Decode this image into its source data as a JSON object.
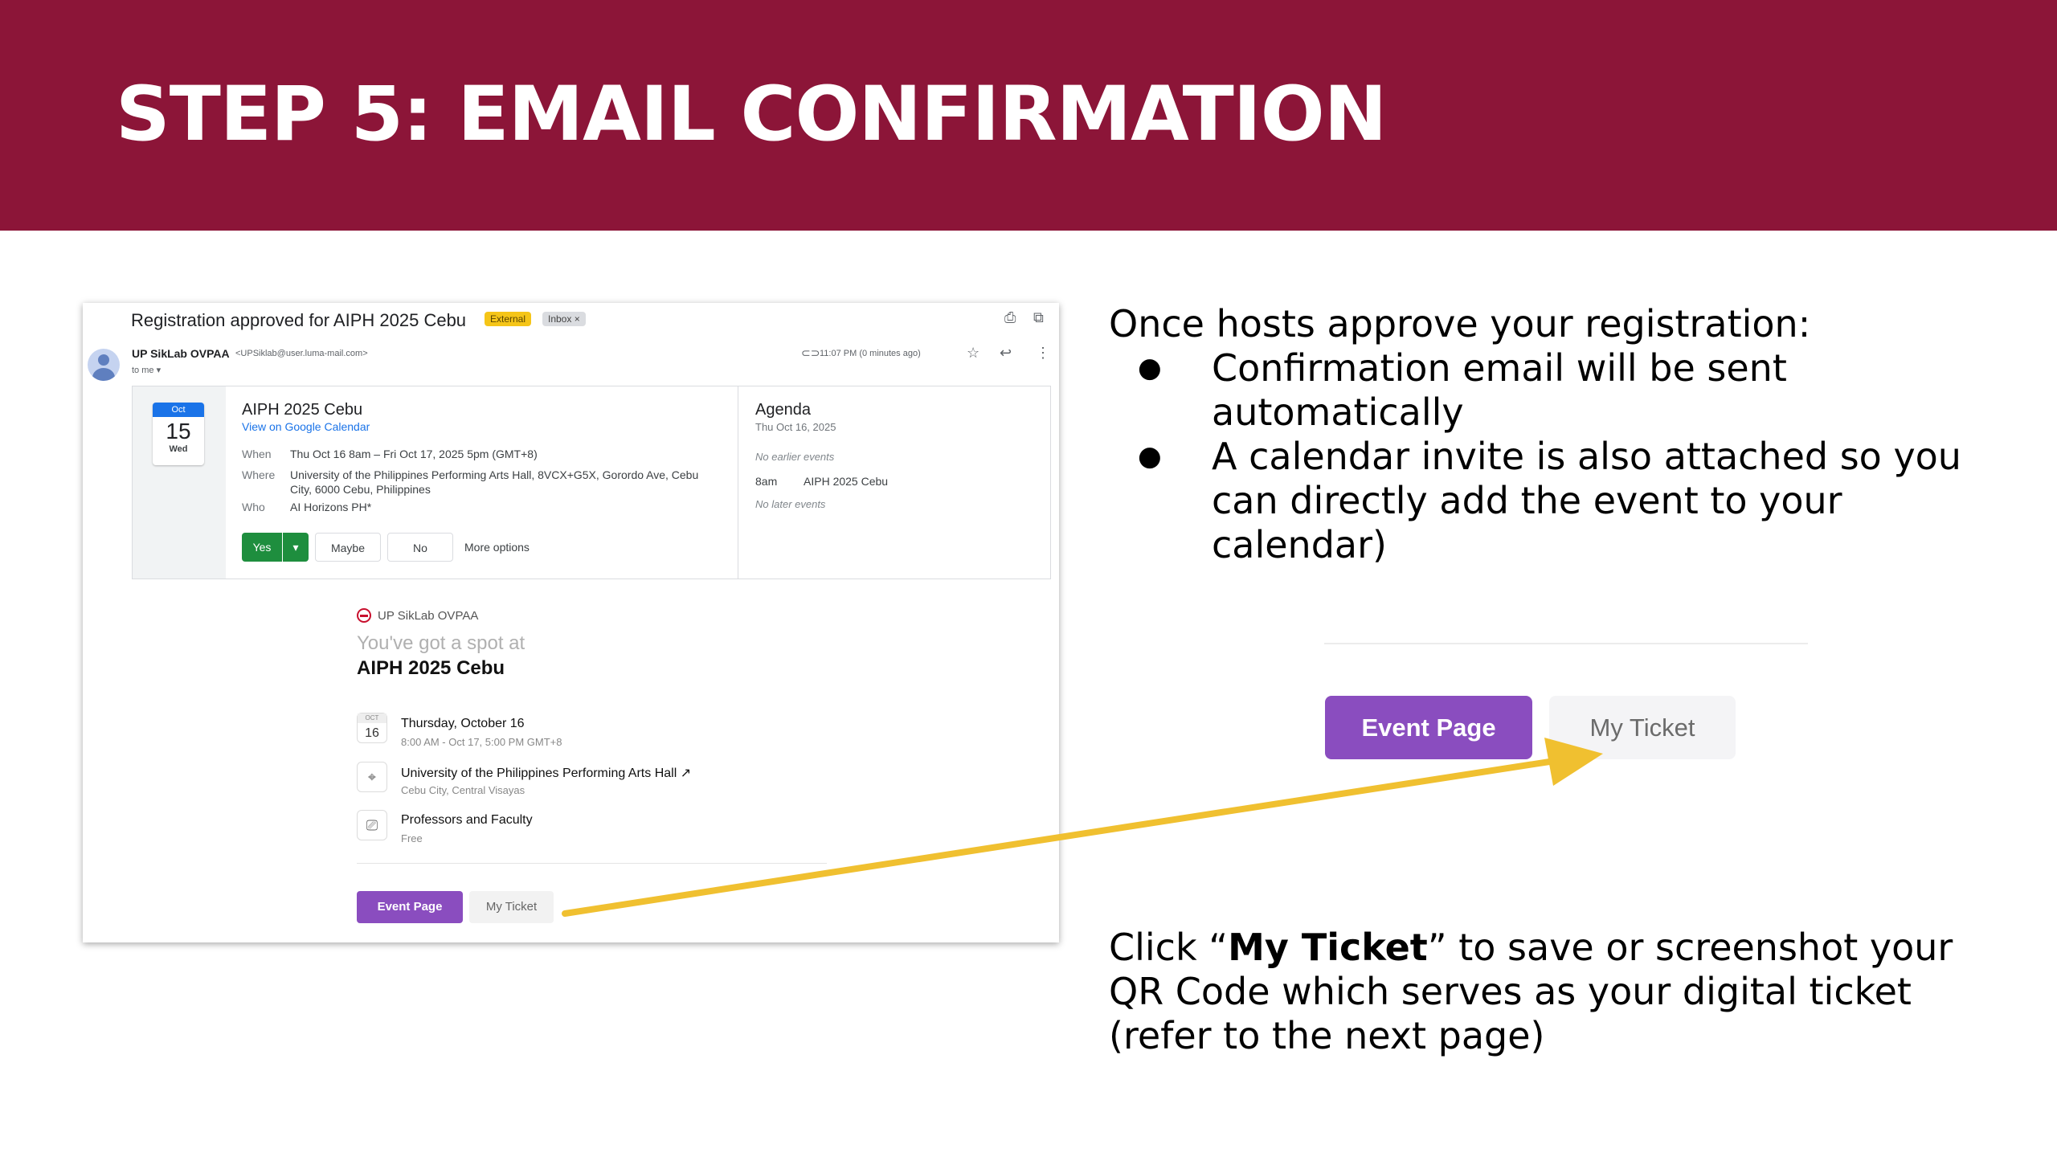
{
  "slide": {
    "title": "STEP 5: EMAIL CONFIRMATION",
    "colors": {
      "header_band": "#8c1538",
      "title_text": "#ffffff",
      "arrow": "#f0c030",
      "luma_purple": "#8a4dbf",
      "rsvp_green": "#1e8e3e",
      "link_blue": "#1a73e8"
    }
  },
  "email": {
    "subject": "Registration approved for AIPH 2025 Cebu",
    "badge_external": "External",
    "badge_inbox": "Inbox ×",
    "sender_name": "UP SikLab OVPAA",
    "sender_email": "<UPSiklab@user.luma-mail.com>",
    "to_line": "to me ▾",
    "timestamp": "11:07 PM (0 minutes ago)",
    "icons": [
      "print-icon",
      "open-new-window-icon",
      "attachment-icon",
      "star-icon",
      "reply-icon",
      "more-vert-icon"
    ],
    "invite": {
      "month": "Oct",
      "day": "15",
      "weekday": "Wed",
      "title": "AIPH 2025 Cebu",
      "calendar_link": "View on Google Calendar",
      "when_label": "When",
      "when_value": "Thu Oct 16 8am – Fri Oct 17, 2025 5pm (GMT+8)",
      "where_label": "Where",
      "where_value_1": "University of the Philippines Performing Arts Hall, 8VCX+G5X, Gorordo Ave, Cebu",
      "where_value_2": "City, 6000 Cebu, Philippines",
      "who_label": "Who",
      "who_value": "AI Horizons PH*",
      "rsvp_yes": "Yes",
      "rsvp_dropdown": "▾",
      "rsvp_maybe": "Maybe",
      "rsvp_no": "No",
      "more_options": "More options"
    },
    "agenda": {
      "title": "Agenda",
      "date": "Thu Oct 16, 2025",
      "no_earlier": "No earlier events",
      "time": "8am",
      "event": "AIPH 2025 Cebu",
      "no_later": "No later events"
    },
    "luma": {
      "org": "UP SikLab OVPAA",
      "spot_text": "You've got a spot at",
      "event_name": "AIPH 2025 Cebu",
      "date_icon_month": "OCT",
      "date_icon_day": "16",
      "date_main": "Thursday, October 16",
      "date_sub": "8:00 AM - Oct 17, 5:00 PM GMT+8",
      "venue_main": "University of the Philippines Performing Arts Hall ↗",
      "venue_sub": "Cebu City, Central Visayas",
      "ticket_main": "Professors and Faculty",
      "ticket_sub": "Free",
      "event_page_button": "Event Page",
      "my_ticket_button": "My Ticket"
    }
  },
  "instructions": {
    "intro": "Once hosts approve your registration:",
    "bullets": [
      "Confirmation email will be sent automatically",
      "A calendar invite is also attached so you can directly add the event to your calendar)"
    ],
    "zoom_event_page": "Event Page",
    "zoom_my_ticket": "My Ticket",
    "outro_prefix": "Click “",
    "outro_bold": "My Ticket",
    "outro_suffix": "” to save or screenshot your QR Code which serves as your digital ticket (refer to the next page)"
  }
}
